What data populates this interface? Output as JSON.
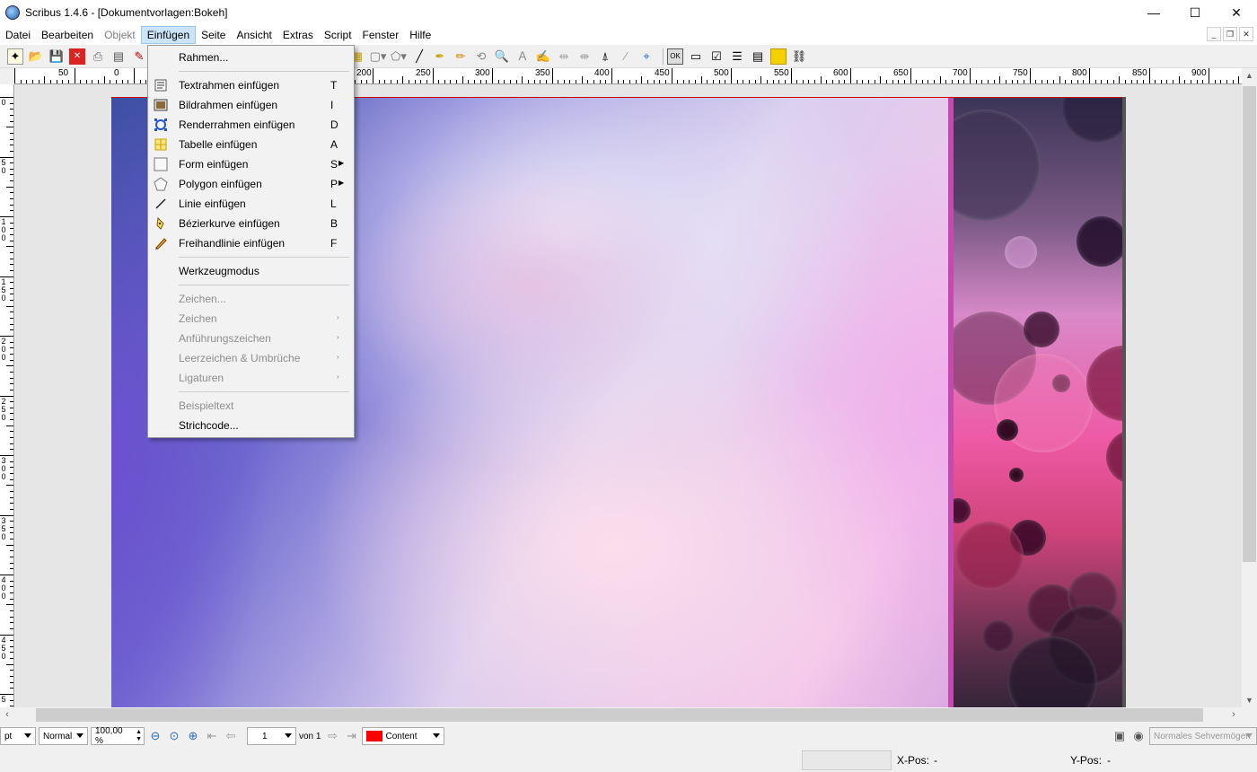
{
  "window": {
    "title": "Scribus 1.4.6 - [Dokumentvorlagen:Bokeh]",
    "min": "—",
    "max": "☐",
    "close": "✕"
  },
  "menubar": [
    "Datei",
    "Bearbeiten",
    "Objekt",
    "Einfügen",
    "Seite",
    "Ansicht",
    "Extras",
    "Script",
    "Fenster",
    "Hilfe"
  ],
  "menubar_state": {
    "disabled": "Objekt",
    "active": "Einfügen"
  },
  "mdi": [
    "_",
    "❐",
    "✕"
  ],
  "hruler_labels": [
    "50",
    "0",
    "200",
    "250",
    "300",
    "350",
    "400",
    "450",
    "500",
    "550",
    "600",
    "650",
    "700",
    "750",
    "800",
    "850",
    "900"
  ],
  "vruler_labels": [
    "0",
    "5\n0",
    "1\n0\n0",
    "1\n5\n0",
    "2\n0\n0",
    "2\n5\n0",
    "3\n0\n0",
    "3\n5\n0",
    "4\n0\n0",
    "4\n5\n0",
    "5"
  ],
  "insert_menu": {
    "frame": "Rahmen...",
    "items": [
      {
        "label": "Textrahmen einfügen",
        "shortcut": "T",
        "icon": "text-frame-icon"
      },
      {
        "label": "Bildrahmen einfügen",
        "shortcut": "I",
        "icon": "image-frame-icon"
      },
      {
        "label": "Renderrahmen einfügen",
        "shortcut": "D",
        "icon": "render-frame-icon"
      },
      {
        "label": "Tabelle einfügen",
        "shortcut": "A",
        "icon": "table-icon"
      },
      {
        "label": "Form einfügen",
        "shortcut": "S",
        "icon": "shape-icon"
      },
      {
        "label": "Polygon einfügen",
        "shortcut": "P",
        "icon": "polygon-icon"
      },
      {
        "label": "Linie einfügen",
        "shortcut": "L",
        "icon": "line-icon"
      },
      {
        "label": "Bézierkurve einfügen",
        "shortcut": "B",
        "icon": "bezier-icon"
      },
      {
        "label": "Freihandlinie einfügen",
        "shortcut": "F",
        "icon": "freehand-icon"
      }
    ],
    "tool_mode": "Werkzeugmodus",
    "disabled_items": [
      "Zeichen...",
      "Zeichen",
      "Anführungszeichen",
      "Leerzeichen & Umbrüche",
      "Ligaturen"
    ],
    "sample_text": "Beispieltext",
    "barcode": "Strichcode..."
  },
  "statusbar": {
    "unit": "pt",
    "mode": "Normal",
    "zoom": "100,00 %",
    "page": "1",
    "page_of": "von 1",
    "layer": "Content",
    "layer_color": "#ff0000",
    "vision": "Normales Sehvermögen"
  },
  "position": {
    "x_label": "X-Pos:",
    "x_value": "-",
    "y_label": "Y-Pos:",
    "y_value": "-"
  }
}
